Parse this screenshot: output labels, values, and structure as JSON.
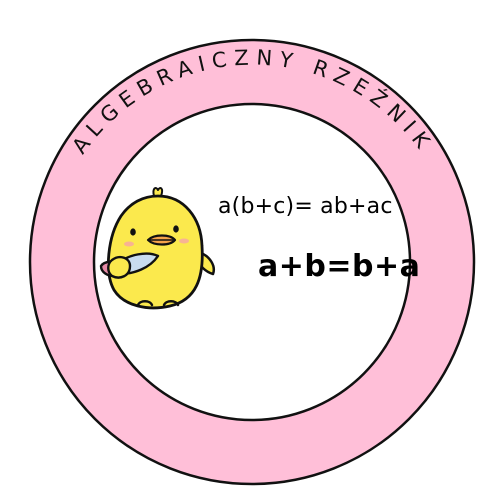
{
  "badge": {
    "title": "ALGEBRAICZNY RZEŹNIK",
    "ring_color": "#ffbfd8",
    "ring_outline_color": "#111111",
    "inner_fill_color": "#ffffff"
  },
  "formulas": {
    "distributive": "a(b+c)= ab+ac",
    "commutative": "a+b=b+a"
  },
  "mascot": {
    "icon": "chick-with-knife-icon",
    "body_color": "#fbe94d",
    "beak_color": "#f4a34b",
    "blush_color": "#f7a9a0",
    "knife_blade_color": "#c9dcef",
    "knife_handle_color": "#e68aa6"
  }
}
